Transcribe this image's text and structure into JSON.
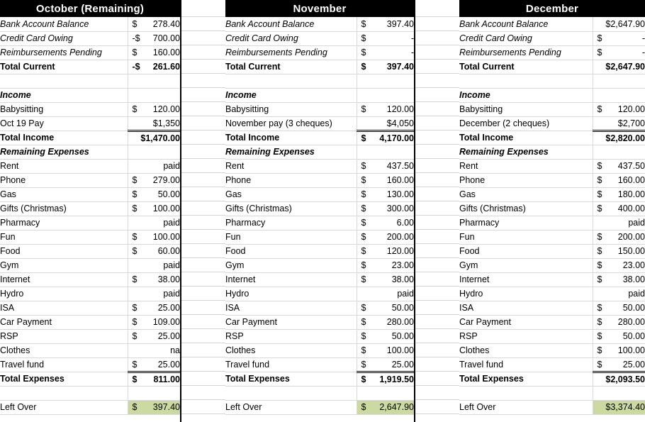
{
  "document": {
    "type": "budget-spreadsheet",
    "colors": {
      "header_bg": "#000000",
      "header_fg": "#ffffff",
      "green": "#00a550",
      "red": "#ff0000",
      "highlight": "#ccd9a0",
      "gridline": "#d9d9d9"
    }
  },
  "labels": {
    "bank_account_balance": "Bank Account Balance",
    "credit_card_owing": "Credit Card Owing",
    "reimbursements_pending": "Reimbursements Pending",
    "total_current": "Total Current",
    "income": "Income",
    "babysitting": "Babysitting",
    "total_income": "Total Income",
    "remaining_expenses": "Remaining Expenses",
    "rent": "Rent",
    "phone": "Phone",
    "gas": "Gas",
    "gifts": "Gifts (Christmas)",
    "pharmacy": "Pharmacy",
    "fun": "Fun",
    "food": "Food",
    "gym": "Gym",
    "internet": "Internet",
    "hydro": "Hydro",
    "isa": "ISA",
    "car_payment": "Car Payment",
    "rsp": "RSP",
    "clothes": "Clothes",
    "travel_fund": "Travel fund",
    "total_expenses": "Total Expenses",
    "left_over": "Left Over"
  },
  "columns": [
    {
      "id": "october",
      "title": "October (Remaining)",
      "bank_account_balance": {
        "cur": "$",
        "amt": "278.40"
      },
      "credit_card_owing": {
        "cur": "-$",
        "amt": "700.00"
      },
      "reimbursements_pending": {
        "cur": "$",
        "amt": "160.00"
      },
      "total_current": {
        "cur": "-$",
        "amt": "261.60"
      },
      "babysitting": {
        "cur": "$",
        "amt": "120.00"
      },
      "pay_label": "Oct 19 Pay",
      "pay_value": {
        "cur": "",
        "amt": "$1,350"
      },
      "total_income": {
        "cur": "",
        "amt": "$1,470.00"
      },
      "expenses": [
        {
          "key": "rent",
          "cur": "",
          "amt": "paid"
        },
        {
          "key": "phone",
          "cur": "$",
          "amt": "279.00"
        },
        {
          "key": "gas",
          "cur": "$",
          "amt": "50.00"
        },
        {
          "key": "gifts",
          "cur": "$",
          "amt": "100.00"
        },
        {
          "key": "pharmacy",
          "cur": "",
          "amt": "paid"
        },
        {
          "key": "fun",
          "cur": "$",
          "amt": "100.00"
        },
        {
          "key": "food",
          "cur": "$",
          "amt": "60.00"
        },
        {
          "key": "gym",
          "cur": "",
          "amt": "paid"
        },
        {
          "key": "internet",
          "cur": "$",
          "amt": "38.00"
        },
        {
          "key": "hydro",
          "cur": "",
          "amt": "paid"
        },
        {
          "key": "isa",
          "cur": "$",
          "amt": "25.00"
        },
        {
          "key": "car_payment",
          "cur": "$",
          "amt": "109.00"
        },
        {
          "key": "rsp",
          "cur": "$",
          "amt": "25.00"
        },
        {
          "key": "clothes",
          "cur": "",
          "amt": "na"
        },
        {
          "key": "travel_fund",
          "cur": "$",
          "amt": "25.00"
        }
      ],
      "total_expenses": {
        "cur": "$",
        "amt": "811.00"
      },
      "left_over": {
        "cur": "$",
        "amt": "397.40"
      }
    },
    {
      "id": "november",
      "title": "November",
      "bank_account_balance": {
        "cur": "$",
        "amt": "397.40"
      },
      "credit_card_owing": {
        "cur": "$",
        "amt": "-"
      },
      "reimbursements_pending": {
        "cur": "$",
        "amt": "-"
      },
      "total_current": {
        "cur": "$",
        "amt": "397.40"
      },
      "babysitting": {
        "cur": "$",
        "amt": "120.00"
      },
      "pay_label": "November pay (3 cheques)",
      "pay_value": {
        "cur": "",
        "amt": "$4,050"
      },
      "total_income": {
        "cur": "$",
        "amt": "4,170.00"
      },
      "expenses": [
        {
          "key": "rent",
          "cur": "$",
          "amt": "437.50"
        },
        {
          "key": "phone",
          "cur": "$",
          "amt": "160.00"
        },
        {
          "key": "gas",
          "cur": "$",
          "amt": "130.00"
        },
        {
          "key": "gifts",
          "cur": "$",
          "amt": "300.00"
        },
        {
          "key": "pharmacy",
          "cur": "$",
          "amt": "6.00"
        },
        {
          "key": "fun",
          "cur": "$",
          "amt": "200.00"
        },
        {
          "key": "food",
          "cur": "$",
          "amt": "120.00"
        },
        {
          "key": "gym",
          "cur": "$",
          "amt": "23.00"
        },
        {
          "key": "internet",
          "cur": "$",
          "amt": "38.00"
        },
        {
          "key": "hydro",
          "cur": "",
          "amt": "paid"
        },
        {
          "key": "isa",
          "cur": "$",
          "amt": "50.00"
        },
        {
          "key": "car_payment",
          "cur": "$",
          "amt": "280.00"
        },
        {
          "key": "rsp",
          "cur": "$",
          "amt": "50.00"
        },
        {
          "key": "clothes",
          "cur": "$",
          "amt": "100.00"
        },
        {
          "key": "travel_fund",
          "cur": "$",
          "amt": "25.00"
        }
      ],
      "total_expenses": {
        "cur": "$",
        "amt": "1,919.50"
      },
      "left_over": {
        "cur": "$",
        "amt": "2,647.90"
      }
    },
    {
      "id": "december",
      "title": "December",
      "bank_account_balance": {
        "cur": "",
        "amt": "$2,647.90"
      },
      "credit_card_owing": {
        "cur": "$",
        "amt": "-"
      },
      "reimbursements_pending": {
        "cur": "$",
        "amt": "-"
      },
      "total_current": {
        "cur": "",
        "amt": "$2,647.90"
      },
      "babysitting": {
        "cur": "$",
        "amt": "120.00"
      },
      "pay_label": "December (2 cheques)",
      "pay_value": {
        "cur": "",
        "amt": "$2,700"
      },
      "total_income": {
        "cur": "",
        "amt": "$2,820.00"
      },
      "expenses": [
        {
          "key": "rent",
          "cur": "$",
          "amt": "437.50"
        },
        {
          "key": "phone",
          "cur": "$",
          "amt": "160.00"
        },
        {
          "key": "gas",
          "cur": "$",
          "amt": "180.00"
        },
        {
          "key": "gifts",
          "cur": "$",
          "amt": "400.00"
        },
        {
          "key": "pharmacy",
          "cur": "",
          "amt": "paid"
        },
        {
          "key": "fun",
          "cur": "$",
          "amt": "200.00"
        },
        {
          "key": "food",
          "cur": "$",
          "amt": "150.00"
        },
        {
          "key": "gym",
          "cur": "$",
          "amt": "23.00"
        },
        {
          "key": "internet",
          "cur": "$",
          "amt": "38.00"
        },
        {
          "key": "hydro",
          "cur": "",
          "amt": "paid"
        },
        {
          "key": "isa",
          "cur": "$",
          "amt": "50.00"
        },
        {
          "key": "car_payment",
          "cur": "$",
          "amt": "280.00"
        },
        {
          "key": "rsp",
          "cur": "$",
          "amt": "50.00"
        },
        {
          "key": "clothes",
          "cur": "$",
          "amt": "100.00"
        },
        {
          "key": "travel_fund",
          "cur": "$",
          "amt": "25.00"
        }
      ],
      "total_expenses": {
        "cur": "",
        "amt": "$2,093.50"
      },
      "left_over": {
        "cur": "",
        "amt": "$3,374.40"
      }
    }
  ]
}
